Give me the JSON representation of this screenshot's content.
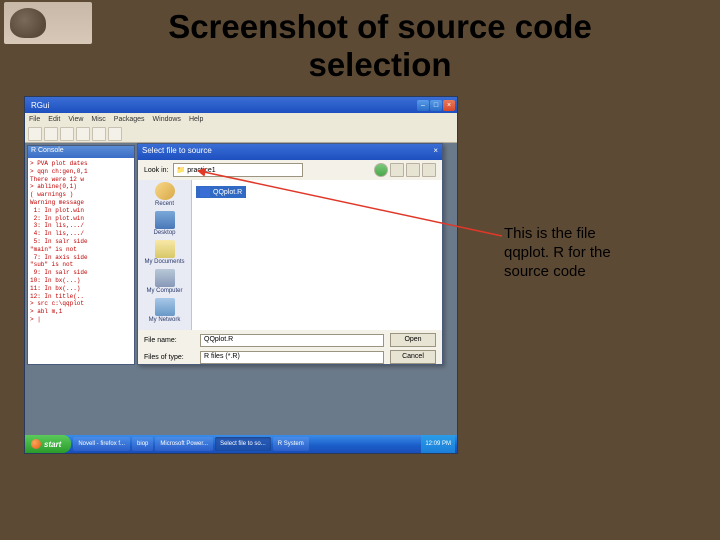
{
  "slide": {
    "title": "Screenshot of source code selection",
    "callout": "This is the file qqplot. R for the source code"
  },
  "rgui": {
    "app_title": "RGui",
    "menus": [
      "File",
      "Edit",
      "View",
      "Misc",
      "Packages",
      "Windows",
      "Help"
    ],
    "console_title": "R Console",
    "console_text": "> PVA plot dates\n> qqn ch:gen,0,1\nThere were 12 w\n> abline(0,1)\n( warnings )\nWarning message\n 1: In plot.win\n 2: In plot.win\n 3: In lis,.../\n 4: In lis,.../\n 5: In salr side\n\"main\" is not\n 7: In axis side\n\"sub\" is not\n 9: In salr side\n10: In bx(...)\n11: In bx(...)\n12: In title(..\n> src c:\\qqplot\n> abl m,1\n> |"
  },
  "dialog": {
    "title": "Select file to source",
    "lookin_label": "Look in:",
    "lookin_value": "practice1",
    "places": [
      {
        "label": "Recent",
        "iconClass": "ic-recent"
      },
      {
        "label": "Desktop",
        "iconClass": "ic-desktop"
      },
      {
        "label": "My Documents",
        "iconClass": "ic-mydocs"
      },
      {
        "label": "My Computer",
        "iconClass": "ic-mycomp"
      },
      {
        "label": "My Network",
        "iconClass": "ic-mynet"
      }
    ],
    "selected_file": "QQplot.R",
    "filename_label": "File name:",
    "filename_value": "QQplot.R",
    "filetype_label": "Files of type:",
    "filetype_value": "R files (*.R)",
    "open_btn": "Open",
    "cancel_btn": "Cancel"
  },
  "taskbar": {
    "start": "start",
    "items": [
      "Novell - firefox f...",
      "biop",
      "Microsoft Power...",
      "Select file to so...",
      "R System"
    ],
    "clock": "12:09 PM"
  },
  "colors": {
    "slide_bg": "#5d4a35",
    "xp_blue": "#1d4fbf",
    "xp_green": "#2a9a2a",
    "arrow": "#e03828"
  }
}
